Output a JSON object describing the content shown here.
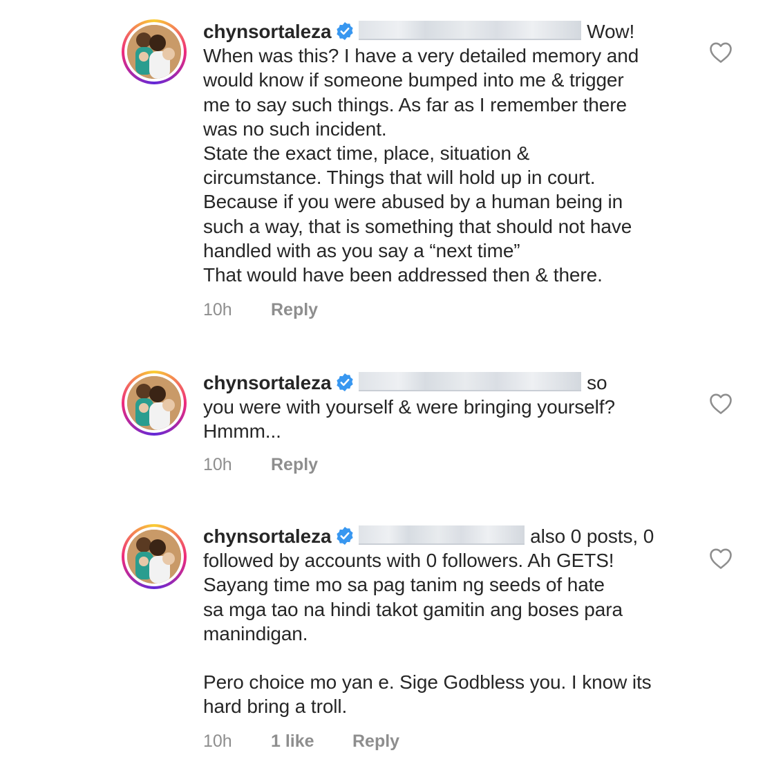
{
  "comments": [
    {
      "username": "chynsortaleza",
      "lead_text": "Wow!",
      "text": "When was this? I have a very detailed memory and\nwould know if someone bumped into me & trigger\nme to say such things. As far as I remember there\nwas no such incident.\nState the exact time, place, situation &\ncircumstance. Things that will hold up in court.\nBecause if you were abused by a human being in\nsuch a way, that is something that should not have\nhandled with as you say a “next time”\nThat would have been addressed then & there.",
      "time": "10h",
      "likes": "",
      "reply_label": "Reply"
    },
    {
      "username": "chynsortaleza",
      "lead_text": "so",
      "text": "you were with yourself & were bringing yourself?\nHmmm...",
      "time": "10h",
      "likes": "",
      "reply_label": "Reply"
    },
    {
      "username": "chynsortaleza",
      "lead_text": "also 0 posts, 0",
      "text": "followed by accounts with 0 followers. Ah GETS!\nSayang time mo sa pag tanim ng seeds of hate\nsa mga tao na hindi takot gamitin ang boses para\nmanindigan.\n\nPero choice mo yan e. Sige Godbless you. I know its\nhard bring a troll.",
      "time": "10h",
      "likes": "1 like",
      "reply_label": "Reply"
    }
  ],
  "icons": {
    "verified": "verified-badge-icon",
    "like": "heart-outline-icon"
  },
  "colors": {
    "verified": "#3897f0",
    "text": "#262626",
    "meta": "#8e8e8e",
    "redaction": "#dfe3e8"
  }
}
